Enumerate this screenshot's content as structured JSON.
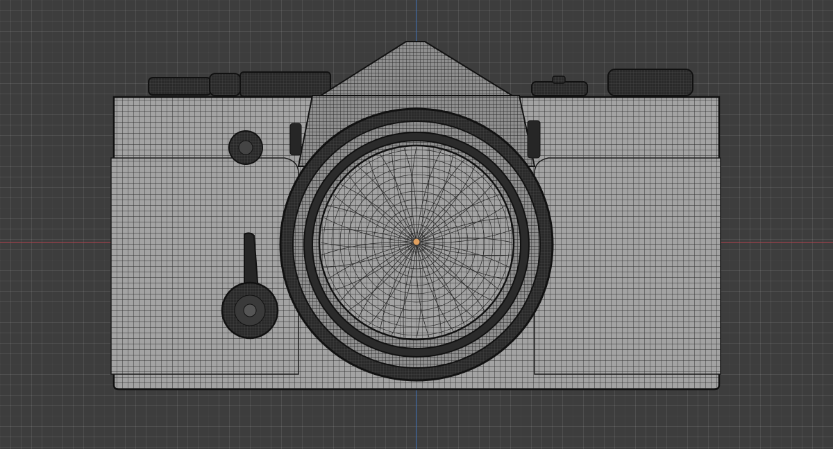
{
  "viewport": {
    "background": "#3d3d3d",
    "grid_color": "#4a4a4a",
    "x_axis_color": "#b2404c",
    "y_axis_color": "#3c6fb4"
  },
  "model": {
    "name_icon": "camera-icon",
    "display_mode": "wireframe",
    "body_color": "#9a9a9a",
    "wire_color": "#1e1e1e",
    "dark_part_color": "#262626",
    "origin_color": "#e0a060"
  }
}
